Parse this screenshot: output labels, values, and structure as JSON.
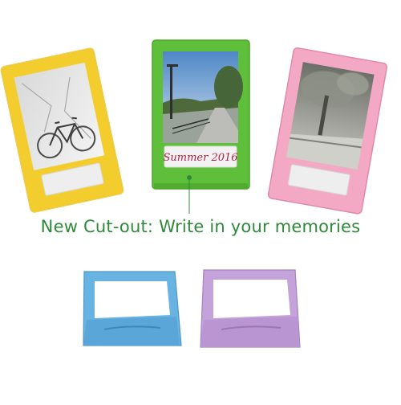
{
  "caption": {
    "text": "New Cut-out: Write in your memories",
    "color": "#2e8a3a"
  },
  "frames": [
    {
      "name": "yellow-frame",
      "color": "#f3cd2e",
      "photo": "bicycle"
    },
    {
      "name": "green-frame",
      "color": "#5fbe3a",
      "photo": "street",
      "label_text": "Summer 2016",
      "label_color": "#b0224a"
    },
    {
      "name": "pink-frame",
      "color": "#f3a9c4",
      "photo": "tree"
    },
    {
      "name": "blue-stand",
      "color": "#69b3e3"
    },
    {
      "name": "purple-stand",
      "color": "#c4a2da"
    }
  ]
}
